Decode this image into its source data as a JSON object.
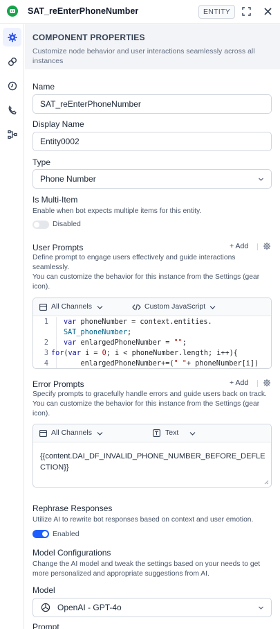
{
  "header": {
    "title": "SAT_reEnterPhoneNumber",
    "badge": "ENTITY",
    "expand_icon": "expand-icon",
    "close_icon": "close-icon"
  },
  "rail": {
    "items": [
      {
        "icon": "gear-icon",
        "active": true
      },
      {
        "icon": "link-icon",
        "active": false
      },
      {
        "icon": "history-icon",
        "active": false
      },
      {
        "icon": "phone-icon",
        "active": false
      },
      {
        "icon": "flow-icon",
        "active": false
      }
    ]
  },
  "section": {
    "title": "COMPONENT PROPERTIES",
    "description": "Customize node behavior and user interactions seamlessly across all instances"
  },
  "fields": {
    "name_label": "Name",
    "name_value": "SAT_reEnterPhoneNumber",
    "display_name_label": "Display Name",
    "display_name_value": "Entity0002",
    "type_label": "Type",
    "type_value": "Phone Number",
    "multi_item_label": "Is Multi-Item",
    "multi_item_description": "Enable when bot expects multiple items for this entity.",
    "multi_item_state": "Disabled"
  },
  "user_prompts": {
    "label": "User Prompts",
    "add_label": "+ Add",
    "description_1": "Define prompt to engage users effectively and guide interactions seamlessly.",
    "description_2": "You can customize the behavior for this instance from the Settings (gear icon).",
    "channel": "All Channels",
    "format": "Custom JavaScript",
    "code_line_numbers": [
      "1",
      "2",
      "3",
      "4"
    ]
  },
  "error_prompts": {
    "label": "Error Prompts",
    "add_label": "+ Add",
    "description": "Specify prompts to gracefully handle errors and guide users back on track. You can customize the behavior for this instance from the Settings (gear icon).",
    "channel": "All Channels",
    "format": "Text",
    "text": "{{content.DAI_DF_INVALID_PHONE_NUMBER_BEFORE_DEFLECTION}}"
  },
  "rephrase": {
    "label": "Rephrase Responses",
    "description": "Utilize AI to rewrite bot responses based on context and user emotion.",
    "state": "Enabled"
  },
  "model_config": {
    "label": "Model Configurations",
    "description": "Change the AI model and tweak the settings based on your needs to get more personalized and appropriate suggestions from AI.",
    "model_label": "Model",
    "model_value": "OpenAI - GPT-4o",
    "prompt_label": "Prompt"
  },
  "colors": {
    "accent": "#1e5eff",
    "brand": "#16a34a",
    "section_bg": "#f2f4f7"
  }
}
